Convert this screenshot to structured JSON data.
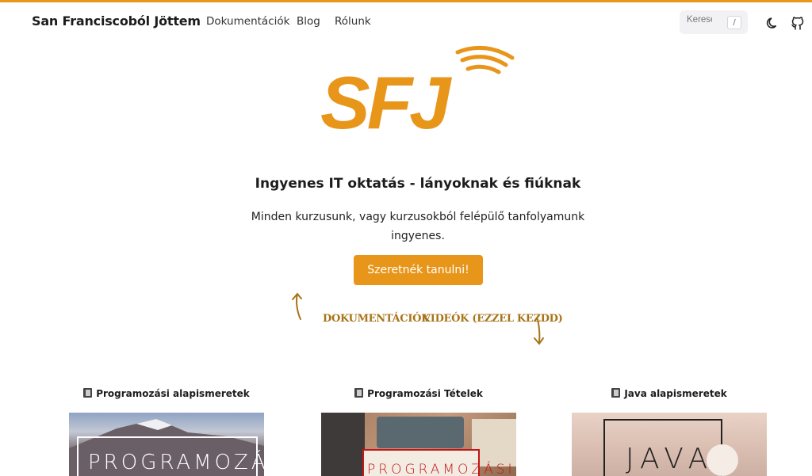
{
  "nav": {
    "brand": "San Franciscoból Jöttem",
    "links": [
      "Dokumentációk",
      "Blog",
      "Rólunk"
    ],
    "search_placeholder": "Keresés",
    "search_shortcut": "/"
  },
  "logo": {
    "text": "SFJ",
    "color": "#e8961a"
  },
  "hero": {
    "title": "Ingyenes IT oktatás - lányoknak és fiúknak",
    "subtitle": "Minden kurzusunk, vagy kurzusokból felépülő tanfolyamunk ingyenes.",
    "cta": "Szeretnék tanulni!"
  },
  "hints": {
    "docs": "DOKUMENTÁCIÓK",
    "videos": "VIDEÓK (EZZEL KEZDD)"
  },
  "cards": [
    {
      "title": "Programozási alapismeretek",
      "thumb_text": "PROGRAMOZÁSI"
    },
    {
      "title": "Programozási Tételek",
      "thumb_text": "PROGRAMOZÁSI"
    },
    {
      "title": "Java alapismeretek",
      "thumb_text": "JAVA"
    }
  ],
  "colors": {
    "accent": "#e8961a"
  }
}
